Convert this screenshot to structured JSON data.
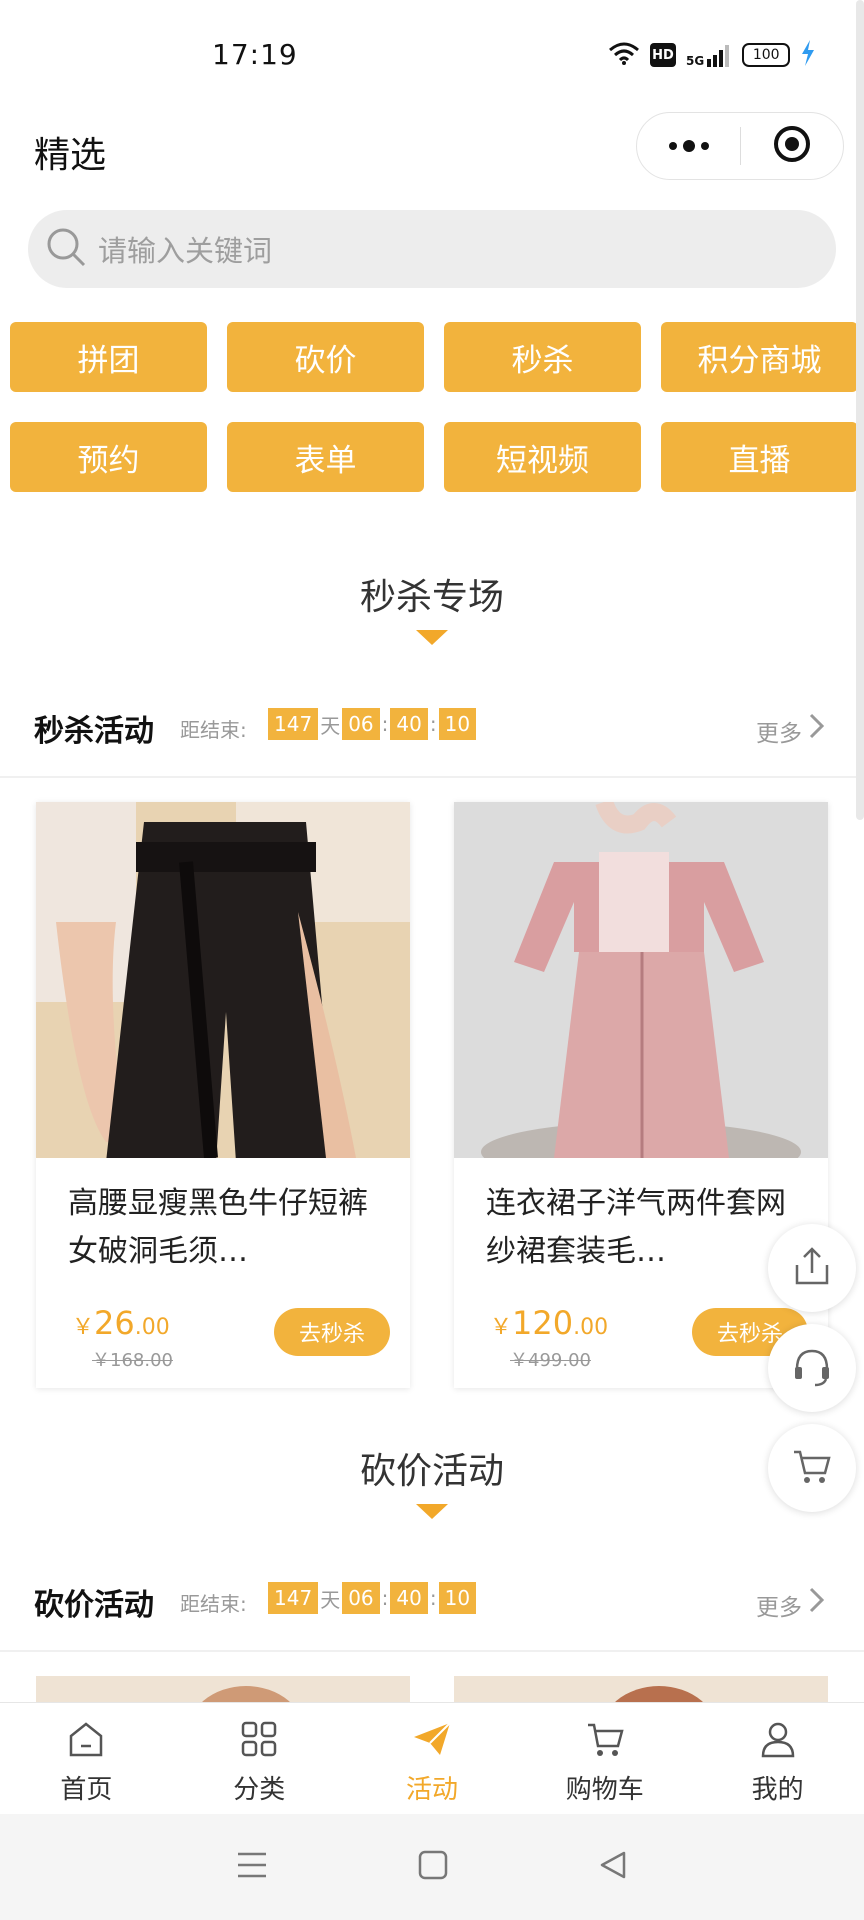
{
  "status": {
    "time": "17:19",
    "hd": "HD",
    "network": "5G",
    "battery": "100"
  },
  "header": {
    "title": "精选"
  },
  "search": {
    "placeholder": "请输入关键词"
  },
  "grid": [
    "拼团",
    "砍价",
    "秒杀",
    "积分商城",
    "预约",
    "表单",
    "短视频",
    "直播"
  ],
  "sections": {
    "seckill": {
      "heading": "秒杀专场",
      "activity_name": "秒杀活动",
      "countdown_label": "距结束:",
      "countdown": {
        "days": "147",
        "day_unit": "天",
        "hours": "06",
        "minutes": "40",
        "seconds": "10",
        "sep": ":"
      },
      "more": "更多"
    },
    "bargain": {
      "heading": "砍价活动",
      "activity_name": "砍价活动",
      "countdown_label": "距结束:",
      "countdown": {
        "days": "147",
        "day_unit": "天",
        "hours": "06",
        "minutes": "40",
        "seconds": "10",
        "sep": ":"
      },
      "more": "更多"
    }
  },
  "products": [
    {
      "name": "高腰显瘦黑色牛仔短裤女破洞毛须…",
      "yen": "￥",
      "price_int": "26",
      "price_dec": ".00",
      "orig": "￥168.00",
      "button": "去秒杀"
    },
    {
      "name": "连衣裙子洋气两件套网纱裙套装毛…",
      "yen": "￥",
      "price_int": "120",
      "price_dec": ".00",
      "orig": "￥499.00",
      "button": "去秒杀"
    }
  ],
  "tabs": [
    {
      "label": "首页",
      "icon": "home-icon"
    },
    {
      "label": "分类",
      "icon": "category-icon"
    },
    {
      "label": "活动",
      "icon": "paper-plane-icon"
    },
    {
      "label": "购物车",
      "icon": "cart-icon"
    },
    {
      "label": "我的",
      "icon": "user-icon"
    }
  ],
  "colors": {
    "accent": "#f2b33d",
    "accent_text": "#f2a82a"
  }
}
